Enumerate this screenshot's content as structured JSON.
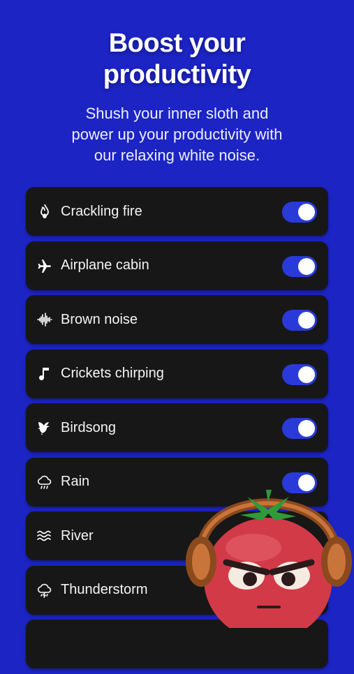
{
  "header": {
    "title_line1": "Boost your",
    "title_line2": "productivity",
    "subtitle_line1": "Shush your inner sloth and",
    "subtitle_line2": "power up your productivity with",
    "subtitle_line3": "our relaxing white noise."
  },
  "sounds": [
    {
      "label": "Crackling fire",
      "icon": "fire-icon",
      "enabled": true
    },
    {
      "label": "Airplane cabin",
      "icon": "airplane-icon",
      "enabled": true
    },
    {
      "label": "Brown noise",
      "icon": "waveform-icon",
      "enabled": true
    },
    {
      "label": "Crickets chirping",
      "icon": "music-note-icon",
      "enabled": true
    },
    {
      "label": "Birdsong",
      "icon": "bird-icon",
      "enabled": true
    },
    {
      "label": "Rain",
      "icon": "rain-cloud-icon",
      "enabled": true
    },
    {
      "label": "River",
      "icon": "waves-icon",
      "enabled": false
    },
    {
      "label": "Thunderstorm",
      "icon": "storm-cloud-icon",
      "enabled": false
    }
  ],
  "colors": {
    "background": "#1c24c4",
    "row": "#171717",
    "toggle_on": "#2a3ad8",
    "mascot": "#d23a48"
  }
}
